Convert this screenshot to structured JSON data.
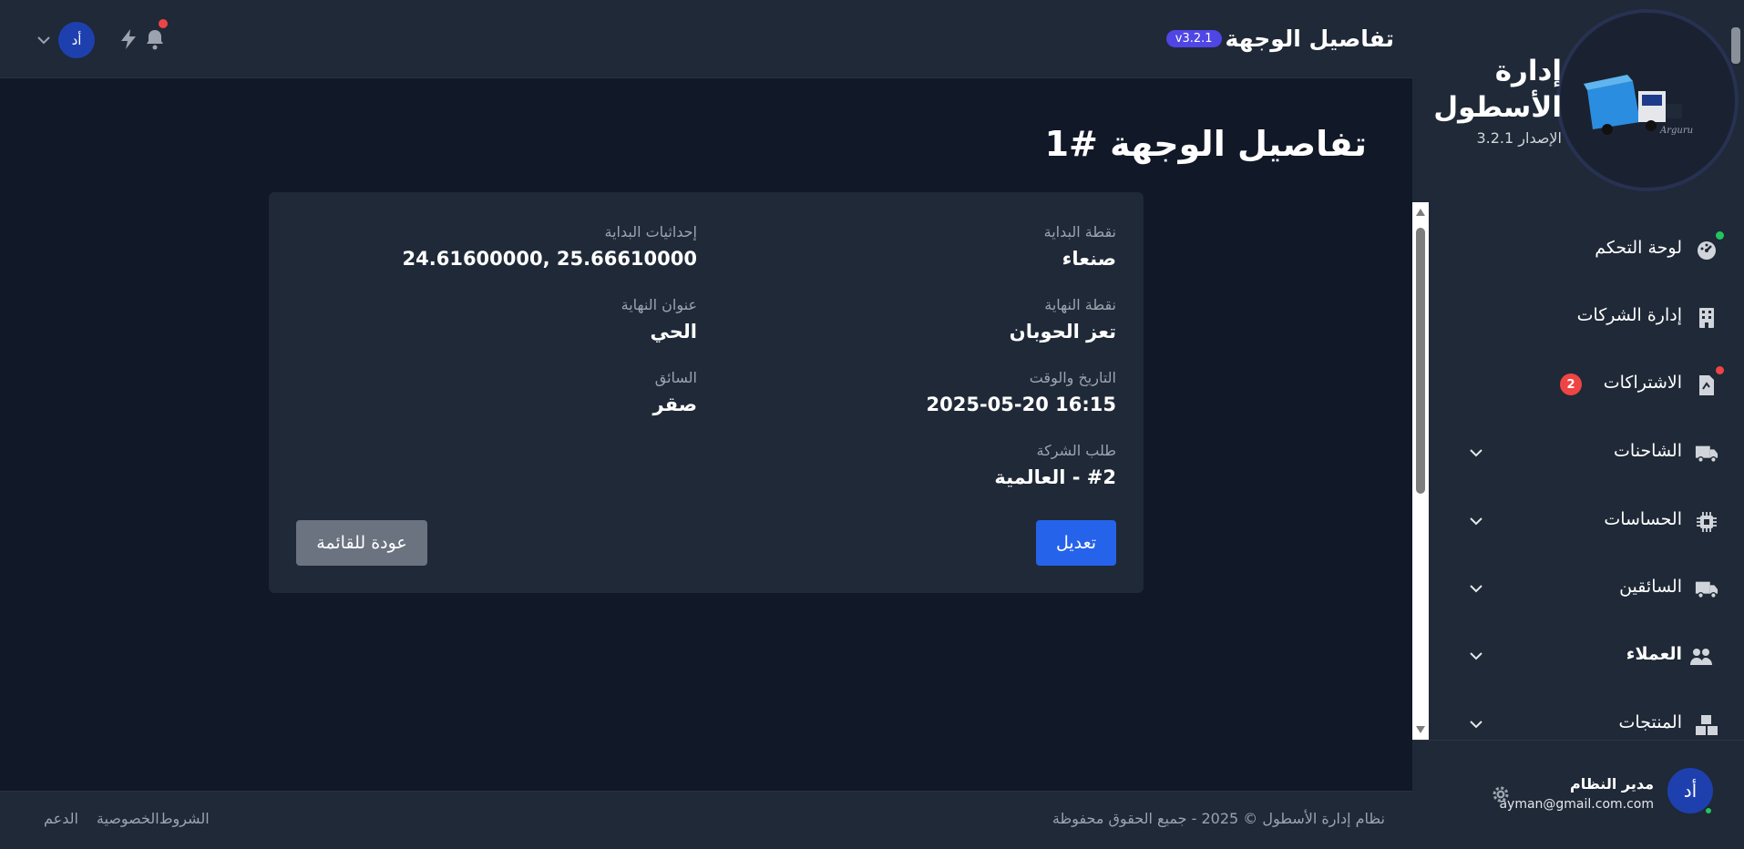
{
  "topbar": {
    "page_title": "تفاصيل الوجهة",
    "version_badge": "v3.2.1",
    "user_initials": "أد"
  },
  "page": {
    "heading": "تفاصيل الوجهة #1"
  },
  "details": {
    "start_point": {
      "label": "نقطة البداية",
      "value": "صنعاء"
    },
    "start_coords": {
      "label": "إحداثيات البداية",
      "value": "24.61600000, 25.66610000"
    },
    "end_point": {
      "label": "نقطة النهاية",
      "value": "تعز الحوبان"
    },
    "end_address": {
      "label": "عنوان النهاية",
      "value": "الحي"
    },
    "datetime": {
      "label": "التاريخ والوقت",
      "value": "2025-05-20 16:15"
    },
    "driver": {
      "label": "السائق",
      "value": "صقر"
    },
    "company_request": {
      "label": "طلب الشركة",
      "value": "#2 - العالمية"
    }
  },
  "actions": {
    "edit_label": "تعديل",
    "back_label": "عودة للقائمة"
  },
  "footer": {
    "copyright": "نظام إدارة الأسطول © 2025 - جميع الحقوق محفوظة",
    "links": [
      "الشروط",
      "الخصوصية",
      "الدعم"
    ]
  },
  "sidebar": {
    "brand_title_line1": "إدارة",
    "brand_title_line2": "الأسطول",
    "brand_version": "الإصدار 3.2.1",
    "items": [
      {
        "label": "لوحة التحكم",
        "icon": "dashboard-icon"
      },
      {
        "label": "إدارة الشركات",
        "icon": "building-icon"
      },
      {
        "label": "الاشتراكات",
        "icon": "file-invoice-icon",
        "badge": "2"
      },
      {
        "label": "الشاحنات",
        "icon": "truck-icon"
      },
      {
        "label": "الحساسات",
        "icon": "chip-icon"
      },
      {
        "label": "السائقين",
        "icon": "truck-icon"
      },
      {
        "label": "العملاء",
        "icon": "users-icon"
      },
      {
        "label": "المنتجات",
        "icon": "boxes-icon"
      }
    ],
    "user": {
      "name": "مدير النظام",
      "email": "ayman@gmail.com.com",
      "initials": "أد"
    }
  },
  "colors": {
    "background": "#111827",
    "surface": "#1f2937",
    "primary": "#2563eb",
    "secondary": "#6b7280",
    "badge": "#4f46e5",
    "danger": "#ef4444",
    "success": "#22c55e"
  }
}
